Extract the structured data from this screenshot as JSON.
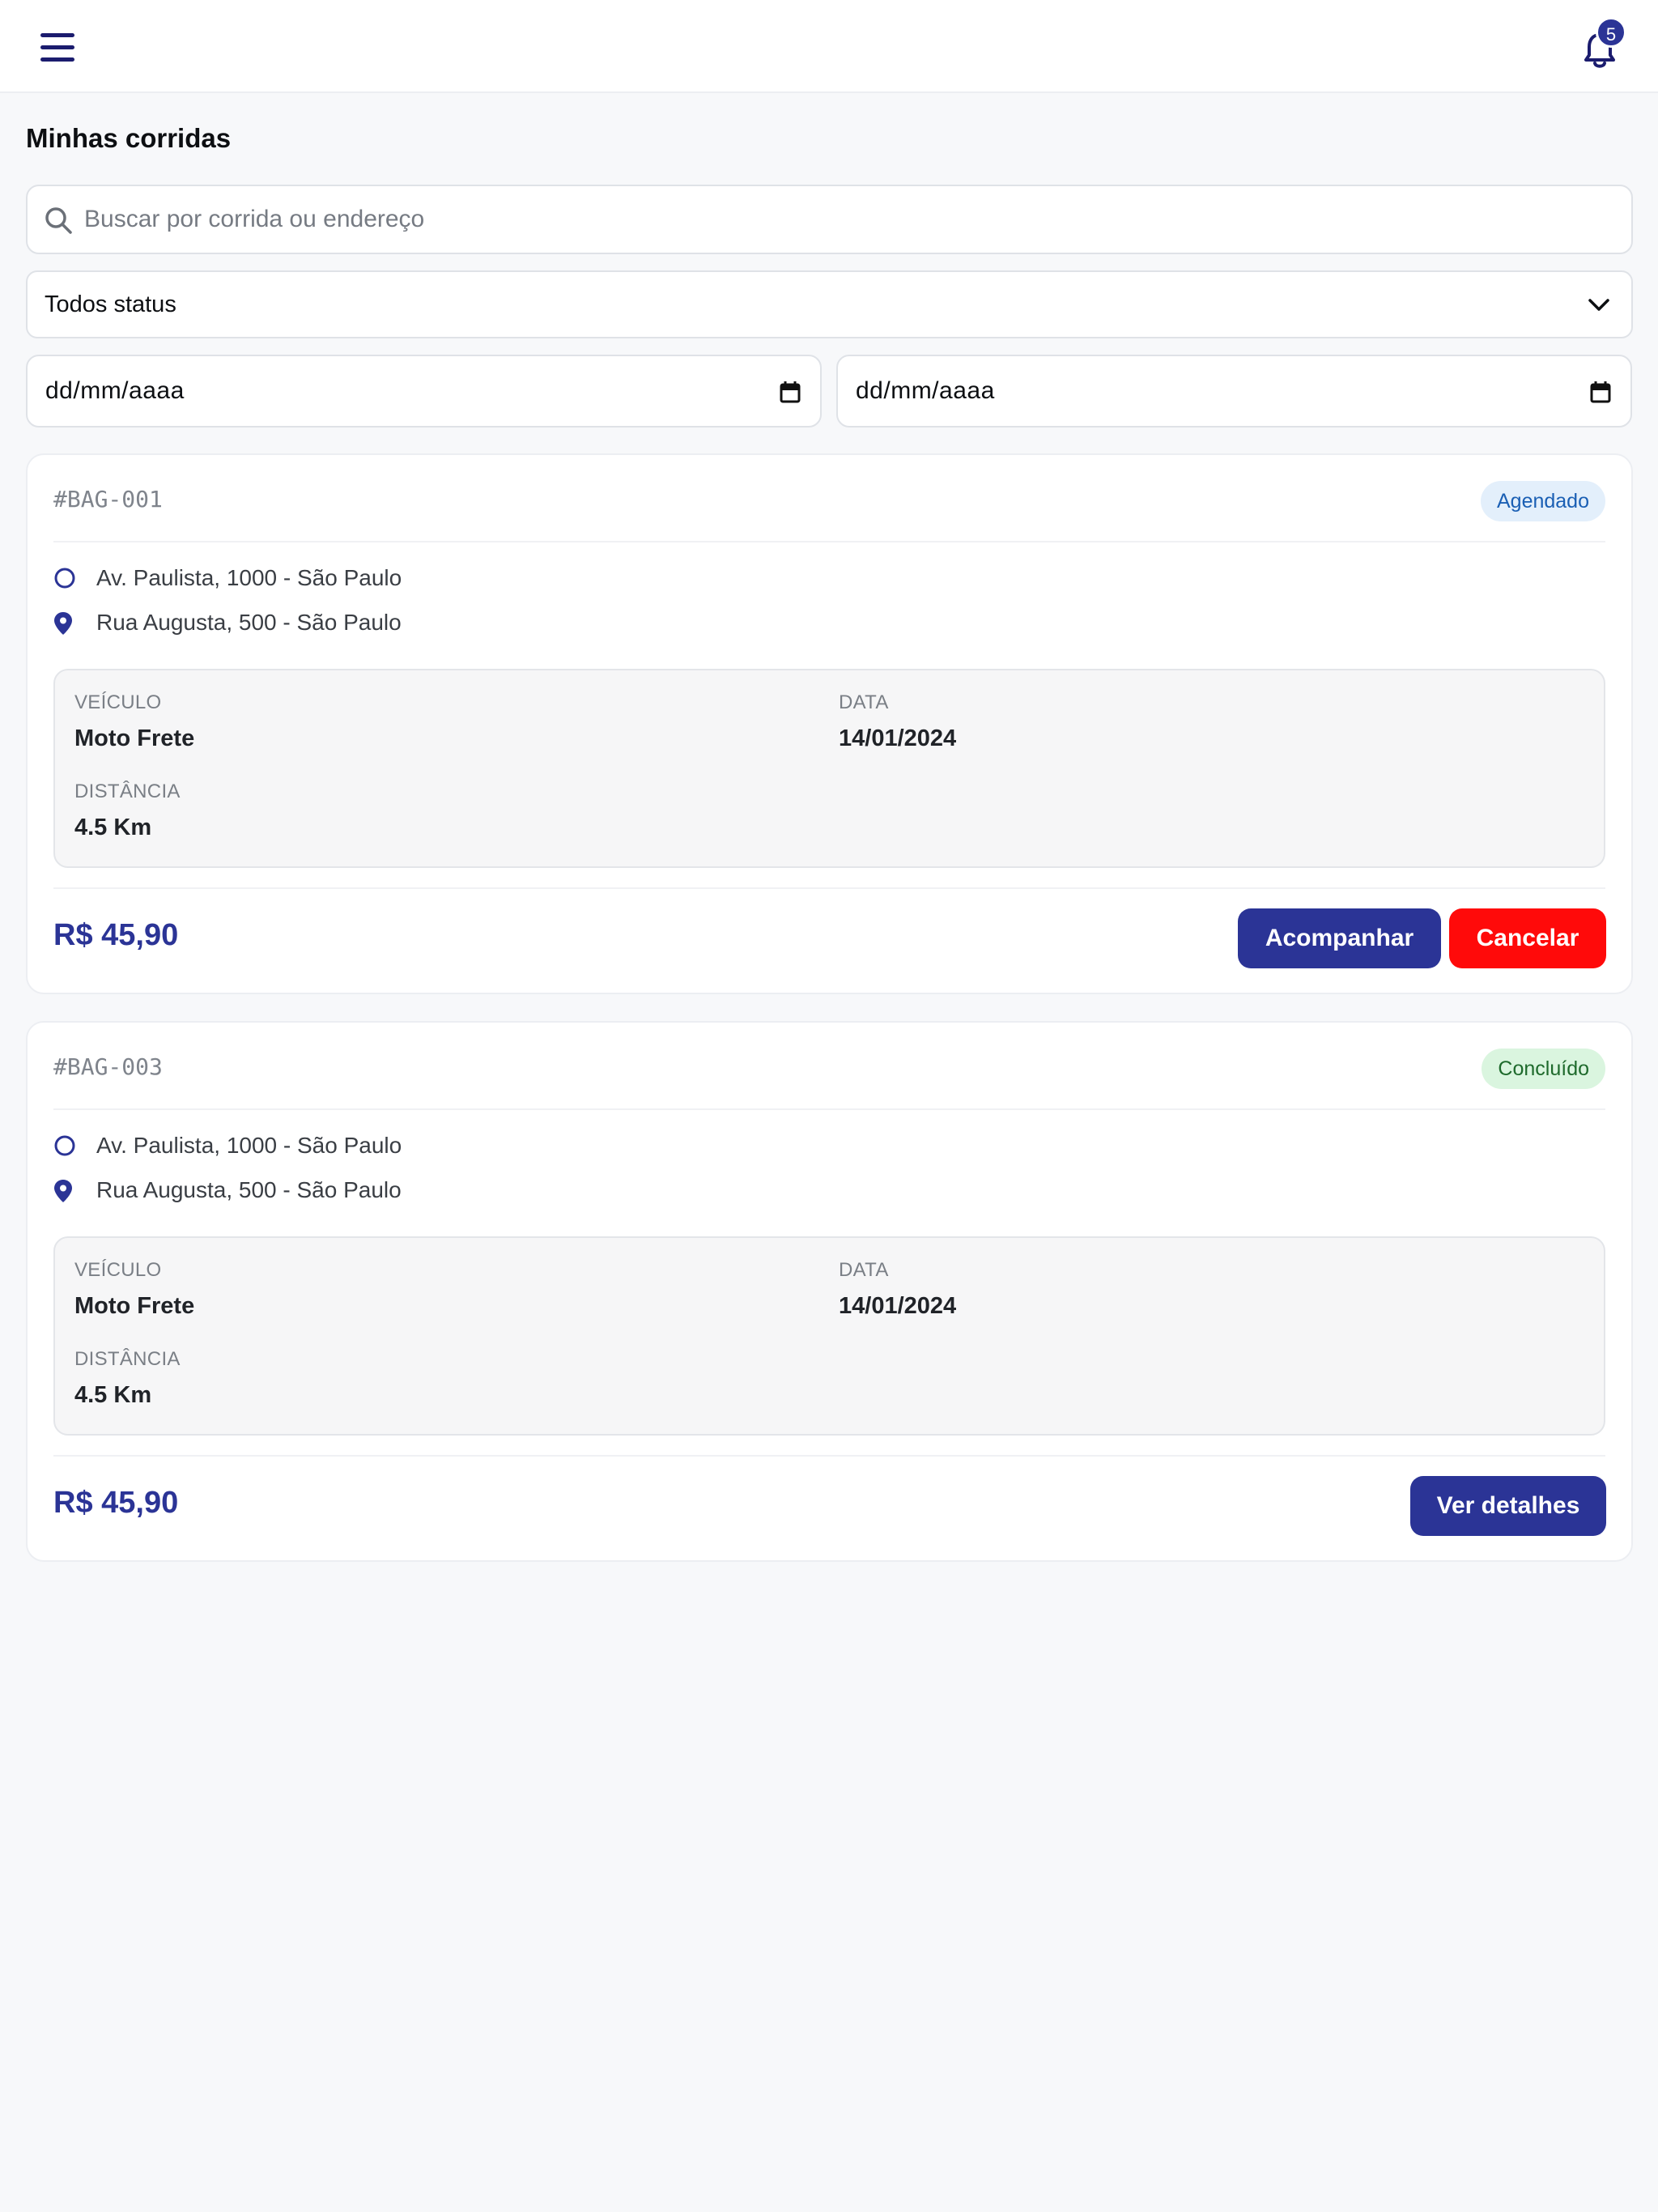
{
  "header": {
    "menu_icon": "hamburger-menu-icon",
    "bell_icon": "bell-icon",
    "notifications_count": "5"
  },
  "page": {
    "title": "Minhas corridas"
  },
  "filters": {
    "search_placeholder": "Buscar por corrida ou endereço",
    "status_selected": "Todos status",
    "date_from_placeholder": "dd/mm/aaaa",
    "date_to_placeholder": "dd/mm/aaaa"
  },
  "labels": {
    "vehicle": "VEÍCULO",
    "date": "DATA",
    "distance": "DISTÂNCIA"
  },
  "rides": [
    {
      "code": "#BAG-001",
      "status": "Agendado",
      "origin": "Av. Paulista, 1000 - São Paulo",
      "destination": "Rua Augusta, 500 - São Paulo",
      "vehicle": "Moto Frete",
      "date": "14/01/2024",
      "distance": "4.5 Km",
      "price": "R$ 45,90",
      "actions": {
        "track": "Acompanhar",
        "cancel": "Cancelar"
      }
    },
    {
      "code": "#BAG-003",
      "status": "Concluído",
      "origin": "Av. Paulista, 1000 - São Paulo",
      "destination": "Rua Augusta, 500 - São Paulo",
      "vehicle": "Moto Frete",
      "date": "14/01/2024",
      "distance": "4.5 Km",
      "price": "R$ 45,90",
      "actions": {
        "details": "Ver detalhes"
      }
    }
  ],
  "colors": {
    "primary": "#2b3496",
    "danger": "#ff0a0a",
    "scheduled_bg": "#e3effb",
    "scheduled_text": "#1a5fb4",
    "done_bg": "#daf5df",
    "done_text": "#1e6a2c"
  }
}
